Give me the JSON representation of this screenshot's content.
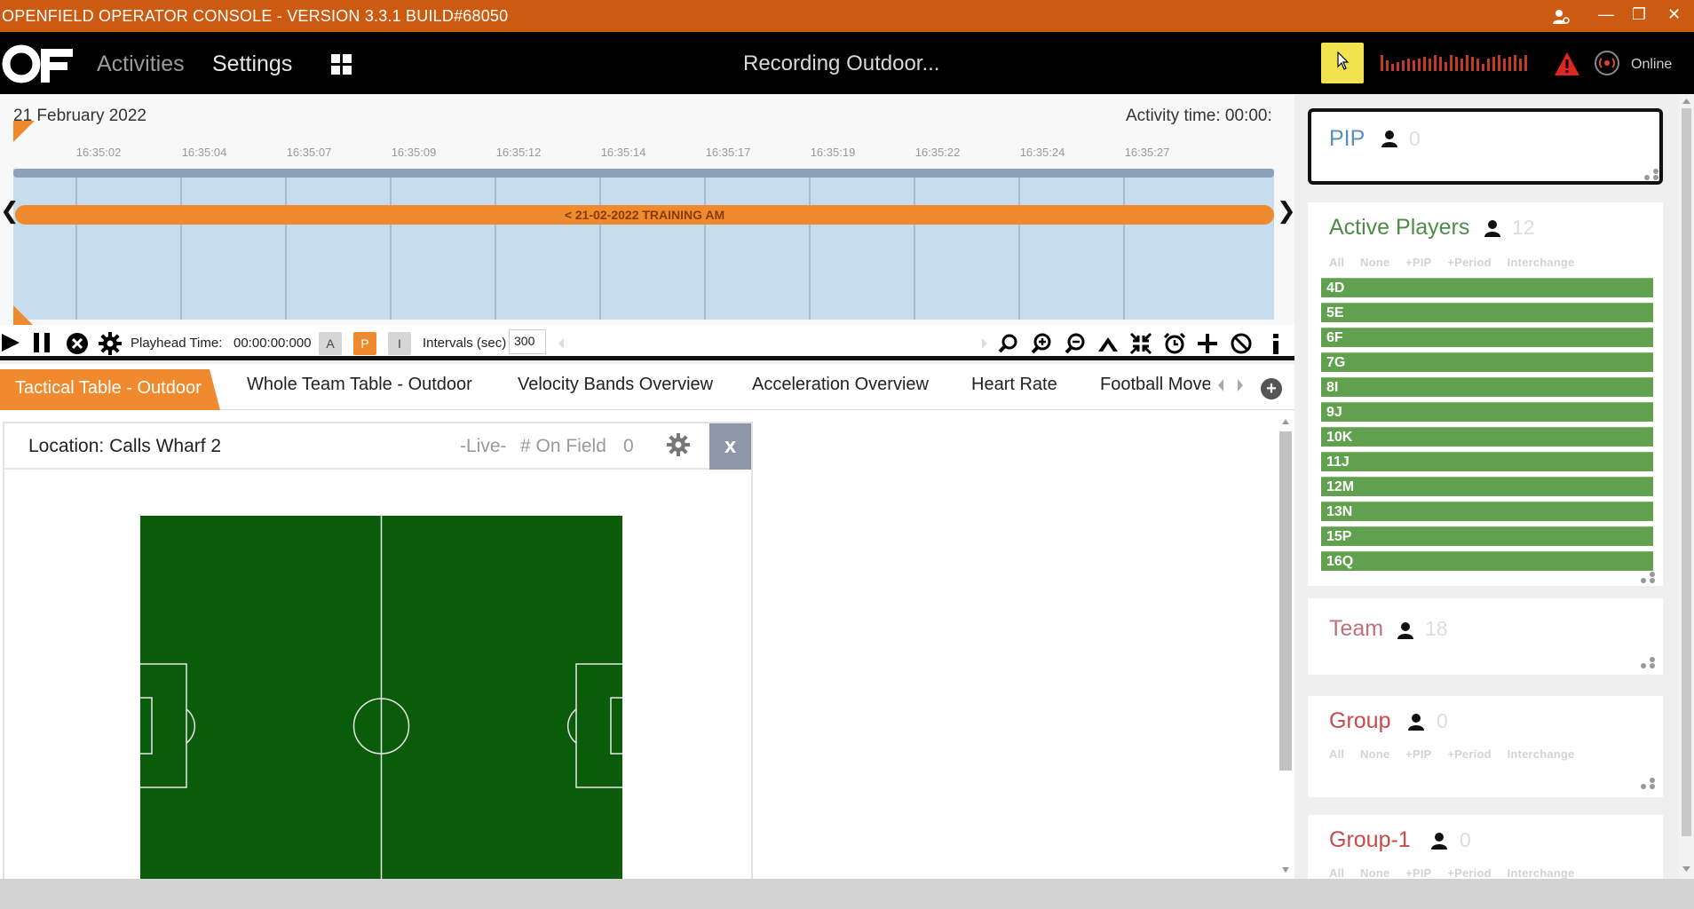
{
  "window": {
    "title": "OPENFIELD OPERATOR CONSOLE - VERSION 3.3.1 BUILD#68050",
    "user_icon": "user-settings-icon",
    "minimize_label": "—",
    "restore_label": "❐",
    "close_label": "✕"
  },
  "nav": {
    "activities": "Activities",
    "settings": "Settings",
    "recording_status": "Recording Outdoor...",
    "online": "Online"
  },
  "timeline": {
    "date": "21 February 2022",
    "activity_time": "Activity time: 00:00:",
    "ticks": [
      "16:35:02",
      "16:35:04",
      "16:35:07",
      "16:35:09",
      "16:35:12",
      "16:35:14",
      "16:35:17",
      "16:35:19",
      "16:35:22",
      "16:35:24",
      "16:35:27"
    ],
    "session_label": "< 21-02-2022 TRAINING AM",
    "arrow_left": "❮",
    "arrow_right": "❯"
  },
  "controls": {
    "playhead_label": "Playhead Time:",
    "playhead_value": "00:00:00:000",
    "mode_a": "A",
    "mode_p": "P",
    "mode_i": "I",
    "intervals_label": "Intervals (sec)",
    "intervals_value": "300"
  },
  "tabs": [
    {
      "label": "Tactical Table - Outdoor",
      "active": true
    },
    {
      "label": "Whole Team Table - Outdoor"
    },
    {
      "label": "Velocity Bands Overview"
    },
    {
      "label": "Acceleration Overview"
    },
    {
      "label": "Heart Rate"
    },
    {
      "label": "Football Move"
    }
  ],
  "panel": {
    "location": "Location: Calls Wharf 2",
    "live": "-Live-",
    "on_field_label": "# On Field",
    "on_field_value": "0",
    "close_label": "x"
  },
  "sidebar": {
    "pip": {
      "title": "PIP",
      "count": "0"
    },
    "active_players": {
      "title": "Active Players",
      "count": "12",
      "filters": [
        "All",
        "None",
        "+PIP",
        "+Period",
        "Interchange"
      ],
      "players": [
        "4D",
        "5E",
        "6F",
        "7G",
        "8I",
        "9J",
        "10K",
        "11J",
        "12M",
        "13N",
        "15P",
        "16Q"
      ]
    },
    "team": {
      "title": "Team",
      "count": "18"
    },
    "group": {
      "title": "Group",
      "count": "0",
      "filters": [
        "All",
        "None",
        "+PIP",
        "+Period",
        "Interchange"
      ]
    },
    "group1": {
      "title": "Group-1",
      "count": "0",
      "filters": [
        "All",
        "None",
        "+PIP",
        "+Period",
        "Interchange"
      ]
    }
  },
  "colors": {
    "title_bar": "#cc5a10",
    "accent_orange": "#f08a2e",
    "player_green": "#61a04e",
    "pitch_green": "#0a5c0a",
    "pip_title": "#5a8fc0",
    "active_players_title": "#4e8c47",
    "team_title": "#c0707a",
    "group_title": "#c84a4a"
  }
}
